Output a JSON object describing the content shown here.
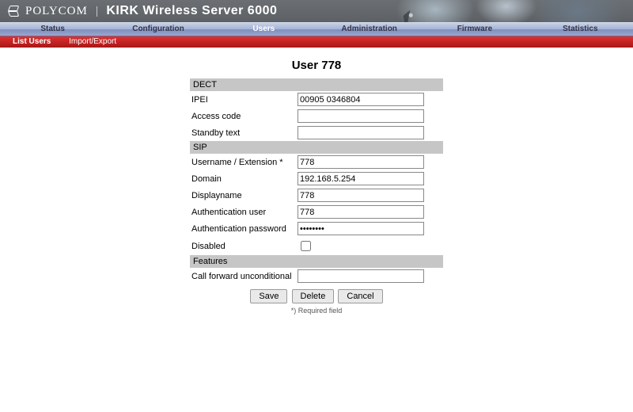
{
  "brand": {
    "company": "POLYCOM",
    "separator": "|",
    "product": "KIRK Wireless Server 6000"
  },
  "topnav": {
    "items": [
      "Status",
      "Configuration",
      "Users",
      "Administration",
      "Firmware",
      "Statistics"
    ],
    "active_index": 2
  },
  "subnav": {
    "items": [
      "List Users",
      "Import/Export"
    ],
    "active_index": 0
  },
  "page": {
    "title": "User 778",
    "sections": {
      "dect": {
        "header": "DECT"
      },
      "sip": {
        "header": "SIP"
      },
      "features": {
        "header": "Features"
      }
    },
    "fields": {
      "ipei": {
        "label": "IPEI",
        "value": "00905 0346804"
      },
      "access_code": {
        "label": "Access code",
        "value": ""
      },
      "standby": {
        "label": "Standby text",
        "value": ""
      },
      "username": {
        "label": "Username / Extension *",
        "value": "778"
      },
      "domain": {
        "label": "Domain",
        "value": "192.168.5.254"
      },
      "displayname": {
        "label": "Displayname",
        "value": "778"
      },
      "authuser": {
        "label": "Authentication user",
        "value": "778"
      },
      "authpwd": {
        "label": "Authentication password",
        "value": "••••••••"
      },
      "disabled": {
        "label": "Disabled",
        "checked": false
      },
      "cfu": {
        "label": "Call forward unconditional",
        "value": ""
      }
    },
    "buttons": {
      "save": "Save",
      "delete": "Delete",
      "cancel": "Cancel"
    },
    "required_note": "*) Required field"
  }
}
